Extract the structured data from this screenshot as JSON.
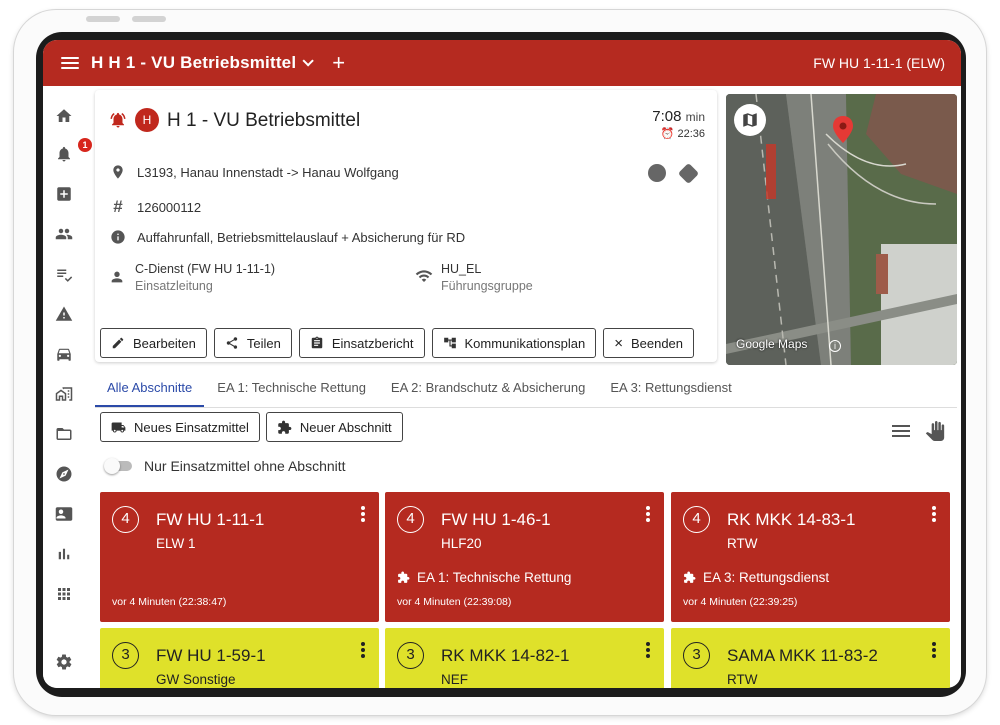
{
  "appbar": {
    "title": "H H 1 - VU Betriebsmittel",
    "add_label": "+",
    "unit": "FW HU 1-11-1 (ELW)"
  },
  "sidebar": {
    "items": [
      {
        "name": "home-icon"
      },
      {
        "name": "alarm-bell-icon",
        "badge": "1"
      },
      {
        "name": "medical-plus-icon"
      },
      {
        "name": "people-icon"
      },
      {
        "name": "checklist-icon"
      },
      {
        "name": "warning-icon"
      },
      {
        "name": "vehicle-icon"
      },
      {
        "name": "buildings-icon"
      },
      {
        "name": "folder-icon"
      },
      {
        "name": "compass-icon"
      },
      {
        "name": "contact-card-icon"
      },
      {
        "name": "bar-chart-icon"
      },
      {
        "name": "apps-grid-icon"
      },
      {
        "name": "settings-gear-icon"
      }
    ]
  },
  "mission": {
    "badge": "H",
    "title": "H 1 - VU Betriebsmittel",
    "elapsed": "7:08",
    "elapsed_unit": "min",
    "alarm_time": "22:36",
    "location": "L3193, Hanau Innenstadt -> Hanau Wolfgang",
    "number": "126000112",
    "description": "Auffahrunfall, Betriebsmittelauslauf + Absicherung für RD",
    "leader_name": "C-Dienst (FW HU 1-11-1)",
    "leader_role": "Einsatzleitung",
    "group_name": "HU_EL",
    "group_role": "Führungsgruppe"
  },
  "actions": {
    "edit": "Bearbeiten",
    "share": "Teilen",
    "report": "Einsatzbericht",
    "comm_plan": "Kommunikationsplan",
    "end": "Beenden"
  },
  "map": {
    "attribution": "Google Maps",
    "info": "i"
  },
  "tabs": [
    {
      "label": "Alle Abschnitte",
      "active": true
    },
    {
      "label": "EA 1: Technische Rettung"
    },
    {
      "label": "EA 2: Brandschutz & Absicherung"
    },
    {
      "label": "EA 3: Rettungsdienst"
    }
  ],
  "toolbar": {
    "new_resource": "Neues Einsatzmittel",
    "new_section": "Neuer Abschnitt",
    "toggle_label": "Nur Einsatzmittel ohne Abschnitt"
  },
  "tiles": [
    {
      "status": "4",
      "name": "FW HU 1-11-1",
      "type": "ELW 1",
      "section": "",
      "since": "vor 4 Minuten (22:38:47)",
      "color": "#b52a20"
    },
    {
      "status": "4",
      "name": "FW HU 1-46-1",
      "type": "HLF20",
      "section": "EA 1: Technische Rettung",
      "since": "vor 4 Minuten (22:39:08)",
      "color": "#b52a20"
    },
    {
      "status": "4",
      "name": "RK MKK 14-83-1",
      "type": "RTW",
      "section": "EA 3: Rettungsdienst",
      "since": "vor 4 Minuten (22:39:25)",
      "color": "#b52a20"
    },
    {
      "status": "3",
      "name": "FW HU 1-59-1",
      "type": "GW Sonstige",
      "color": "#dfe12a"
    },
    {
      "status": "3",
      "name": "RK MKK 14-82-1",
      "type": "NEF",
      "color": "#dfe12a"
    },
    {
      "status": "3",
      "name": "SAMA MKK 11-83-2",
      "type": "RTW",
      "color": "#dfe12a"
    }
  ]
}
